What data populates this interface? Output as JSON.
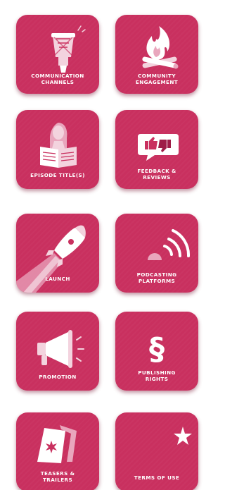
{
  "colors": {
    "tile": "#c9305f",
    "icon_light": "#f3d3de",
    "icon_mid": "#e9a6bd",
    "icon_dark": "#9e1e48",
    "text": "#ffffff"
  },
  "tiles": [
    {
      "label": "COMMUNICATION\nCHANNELS",
      "icon": "drum-icon"
    },
    {
      "label": "COMMUNITY\nENGAGEMENT",
      "icon": "campfire-icon"
    },
    {
      "label": "EPISODE TITLE(S)",
      "icon": "reader-newspaper-icon"
    },
    {
      "label": "FEEDBACK &\nREVIEWS",
      "icon": "thumbs-chat-icon"
    },
    {
      "label": "LAUNCH",
      "icon": "rocket-icon"
    },
    {
      "label": "PODCASTING\nPLATFORMS",
      "icon": "signal-waves-icon"
    },
    {
      "label": "PROMOTION",
      "icon": "megaphone-icon"
    },
    {
      "label": "PUBLISHING\nRIGHTS",
      "icon": "section-sign-icon"
    },
    {
      "label": "TEASERS &\nTRAILERS",
      "icon": "sign-board-icon"
    },
    {
      "label": "TERMS OF USE",
      "icon": "star-icon"
    }
  ],
  "glyphs": {
    "section": "§"
  }
}
